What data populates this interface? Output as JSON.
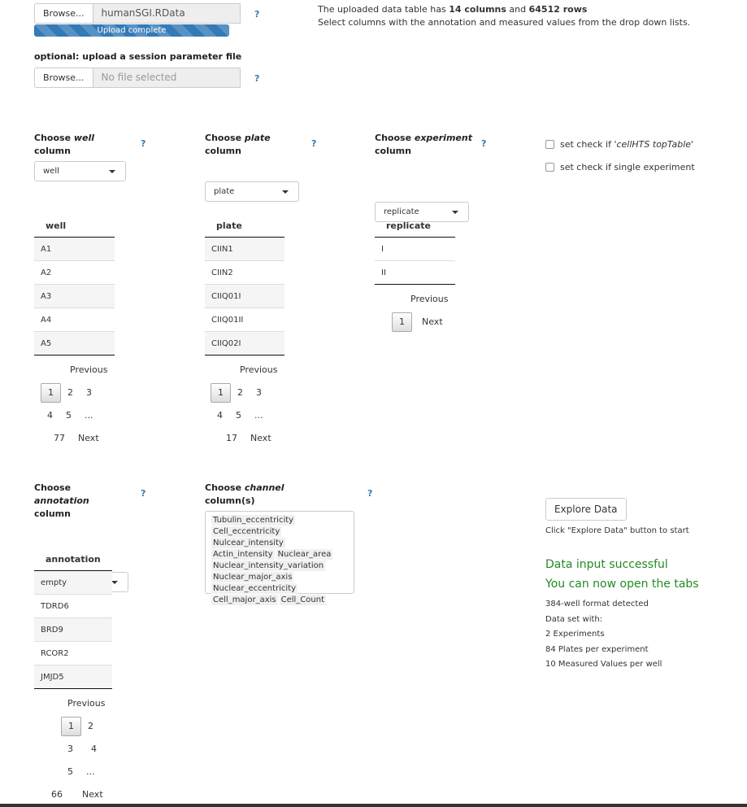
{
  "upload": {
    "browse_label": "Browse...",
    "file_name": "humanSGI.RData",
    "progress_label": "Upload complete",
    "progress_fraction": 1.0,
    "help": "?"
  },
  "info": {
    "line1_prefix": "The uploaded data table has ",
    "columns": "14 columns",
    "and": " and ",
    "rows": "64512 rows",
    "line2": "Select columns with the annotation and measured values from the drop down lists."
  },
  "session": {
    "label": "optional: upload a session parameter file",
    "browse_label": "Browse...",
    "file_placeholder": "No file selected",
    "help": "?"
  },
  "choosers": {
    "well": {
      "pre": "Choose ",
      "em": "well",
      "post": "column",
      "value": "well",
      "help": "?"
    },
    "plate": {
      "pre": "Choose ",
      "em": "plate",
      "post": "column",
      "value": "plate",
      "help": "?"
    },
    "experiment": {
      "pre": "Choose ",
      "em": "experiment",
      "post": "column",
      "value": "replicate",
      "help": "?"
    },
    "annotation": {
      "pre": "Choose ",
      "em": "annotation",
      "post": "column",
      "value": "annotation",
      "help": "?"
    },
    "channel": {
      "pre": "Choose ",
      "em": "channel",
      "post": "column(s)",
      "help": "?"
    }
  },
  "checks": {
    "toptable_pre": "set check if ",
    "toptable_em": "'cellHTS topTable'",
    "single": "set check if single experiment"
  },
  "tables": {
    "well": {
      "header": "well",
      "rows": [
        "A1",
        "A2",
        "A3",
        "A4",
        "A5"
      ],
      "pager": {
        "previous": "Previous",
        "pages_row1": [
          "1",
          "2",
          "3"
        ],
        "pages_row2": [
          "4",
          "5",
          "..."
        ],
        "last": "77",
        "next": "Next"
      }
    },
    "plate": {
      "header": "plate",
      "rows": [
        "CIIN1",
        "CIIN2",
        "CIIQ01I",
        "CIIQ01II",
        "CIIQ02I"
      ],
      "pager": {
        "previous": "Previous",
        "pages_row1": [
          "1",
          "2",
          "3"
        ],
        "pages_row2": [
          "4",
          "5",
          "..."
        ],
        "last": "17",
        "next": "Next"
      }
    },
    "replicate": {
      "header": "replicate",
      "rows": [
        "I",
        "II"
      ],
      "pager": {
        "previous": "Previous",
        "current": "1",
        "next": "Next"
      }
    },
    "annotation": {
      "header": "annotation",
      "rows": [
        "empty",
        "TDRD6",
        "BRD9",
        "RCOR2",
        "JMJD5"
      ],
      "pager": {
        "previous": "Previous",
        "pages_row1": [
          "1",
          "2"
        ],
        "pages_row2": [
          "3",
          "4"
        ],
        "pages_row3": [
          "5",
          "..."
        ],
        "last": "66",
        "next": "Next"
      }
    }
  },
  "channels": [
    [
      "Tubulin_eccentricity"
    ],
    [
      "Cell_eccentricity",
      "Nulcear_intensity"
    ],
    [
      "Actin_intensity",
      "Nuclear_area"
    ],
    [
      "Nuclear_intensity_variation"
    ],
    [
      "Nuclear_major_axis"
    ],
    [
      "Nuclear_eccentricity"
    ],
    [
      "Cell_major_axis",
      "Cell_Count"
    ]
  ],
  "explore": {
    "button": "Explore Data",
    "hint": "Click \"Explore Data\" button to start",
    "success1": "Data input successful",
    "success2": "You can now open the tabs",
    "details": [
      "384-well format detected",
      "Data set with:",
      "2 Experiments",
      "84 Plates per experiment",
      "10 Measured Values per well"
    ]
  },
  "colors": {
    "accent": "#337ab7",
    "success": "#228b22"
  }
}
